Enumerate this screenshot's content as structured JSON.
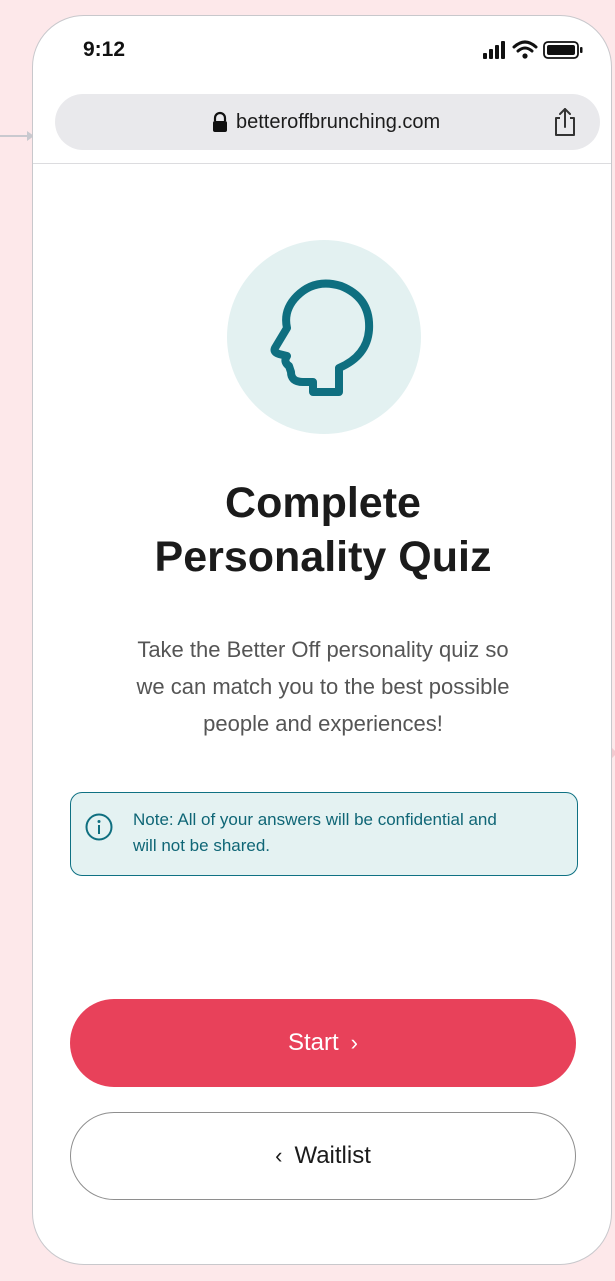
{
  "status_bar": {
    "time": "9:12"
  },
  "browser": {
    "url": "betteroffbrunching.com"
  },
  "quiz": {
    "title_line1": "Complete",
    "title_line2": "Personality Quiz",
    "description_line1": "Take the Better Off personality quiz so",
    "description_line2": "we can match you to the best possible",
    "description_line3": "people and experiences!",
    "note_line1": "Note: All of your answers will be confidential and",
    "note_line2": "will not be shared."
  },
  "buttons": {
    "start_label": "Start",
    "start_chevron": "›",
    "waitlist_label": "Waitlist",
    "waitlist_chevron": "‹"
  },
  "colors": {
    "page_background": "#fde8ea",
    "accent": "#e8415a",
    "teal": "#0f7183",
    "teal_tint": "#e3f1f1"
  },
  "icons": {
    "lock": "lock-icon",
    "share": "share-icon",
    "hero": "head-profile-icon",
    "note": "info-icon",
    "signal": "cellular-signal-icon",
    "wifi": "wifi-icon",
    "battery": "battery-icon"
  }
}
